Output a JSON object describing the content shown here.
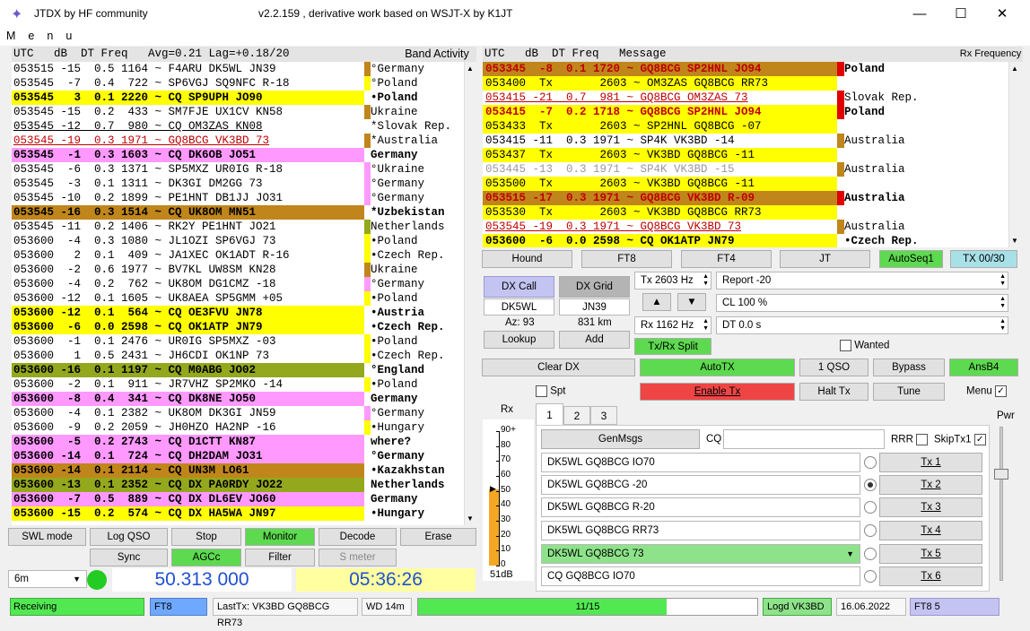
{
  "window": {
    "title": "JTDX  by HF community",
    "subtitle": "v2.2.159 , derivative work based on WSJT-X by K1JT"
  },
  "menu": "Menu",
  "left": {
    "header": "UTC   dB  DT Freq   Avg=0.21 Lag=+0.18/20",
    "band_label": "Band Activity",
    "rows": [
      {
        "t": "053515 -15  0.5 1164 ~ F4ARU DK5WL JN39",
        "m": "°",
        "c": "Germany",
        "bg": "#ffffff",
        "fg": "#000",
        "mk": "#c0861b",
        "bold": false,
        "ul": false
      },
      {
        "t": "053545  -7  0.4  722 ~ SP6VGJ SQ9NFC R-18",
        "m": "°",
        "c": "Poland",
        "bg": "#ffffff",
        "fg": "#000",
        "mk": "#ffff00",
        "bold": false,
        "ul": false
      },
      {
        "t": "053545   3  0.1 2220 ~ CQ SP9UPH JO90",
        "m": "•",
        "c": "Poland",
        "bg": "#ffff00",
        "fg": "#000",
        "mk": "#fff",
        "bold": true,
        "ul": false
      },
      {
        "t": "053545 -15  0.2  433 ~ SM7FJE UX1CV KN58",
        "m": "",
        "c": "Ukraine",
        "bg": "#ffffff",
        "fg": "#000",
        "mk": "#c0861b",
        "bold": false,
        "ul": false
      },
      {
        "t": "053545 -12  0.7  980 ~ CQ OM3ZAS KN08",
        "m": "*",
        "c": "Slovak Rep.",
        "bg": "#ffffff",
        "fg": "#000",
        "mk": "#fff",
        "bold": false,
        "ul": true
      },
      {
        "t": "053545 -19  0.3 1971 ~ GQ8BCG VK3BD 73",
        "m": "*",
        "c": "Australia",
        "bg": "#ffffff",
        "fg": "#c00000",
        "mk": "#c0861b",
        "bold": false,
        "ul": true
      },
      {
        "t": "053545  -1  0.3 1603 ~ CQ DK6OB JO51",
        "m": "",
        "c": "Germany",
        "bg": "#ff99ff",
        "fg": "#000",
        "mk": "#fff",
        "bold": true,
        "ul": false
      },
      {
        "t": "053545  -6  0.3 1371 ~ SP5MXZ UR0IG R-18",
        "m": "°",
        "c": "Ukraine",
        "bg": "#ffffff",
        "fg": "#000",
        "mk": "#ff99ff",
        "bold": false,
        "ul": false
      },
      {
        "t": "053545  -3  0.1 1311 ~ DK3GI DM2GG 73",
        "m": "°",
        "c": "Germany",
        "bg": "#ffffff",
        "fg": "#000",
        "mk": "#ff99ff",
        "bold": false,
        "ul": false
      },
      {
        "t": "053545 -10  0.2 1899 ~ PE1HNT DB1JJ JO31",
        "m": "°",
        "c": "Germany",
        "bg": "#ffffff",
        "fg": "#000",
        "mk": "#ff99ff",
        "bold": false,
        "ul": false
      },
      {
        "t": "053545 -16  0.3 1514 ~ CQ UK8OM MN51",
        "m": "*",
        "c": "Uzbekistan",
        "bg": "#c0861b",
        "fg": "#000",
        "mk": "#fff",
        "bold": true,
        "ul": false
      },
      {
        "t": "053545 -11  0.2 1406 ~ RK2Y PE1HNT JO21",
        "m": "",
        "c": "Netherlands",
        "bg": "#ffffff",
        "fg": "#000",
        "mk": "#93a81c",
        "bold": false,
        "ul": false
      },
      {
        "t": "053600  -4  0.3 1080 ~ JL1OZI SP6VGJ 73",
        "m": "•",
        "c": "Poland",
        "bg": "#ffffff",
        "fg": "#000",
        "mk": "#ffff00",
        "bold": false,
        "ul": false
      },
      {
        "t": "053600   2  0.1  409 ~ JA1XEC OK1ADT R-16",
        "m": "•",
        "c": "Czech Rep.",
        "bg": "#ffffff",
        "fg": "#000",
        "mk": "#ffff00",
        "bold": false,
        "ul": false
      },
      {
        "t": "053600  -2  0.6 1977 ~ BV7KL UW8SM KN28",
        "m": "",
        "c": "Ukraine",
        "bg": "#ffffff",
        "fg": "#000",
        "mk": "#c0861b",
        "bold": false,
        "ul": false
      },
      {
        "t": "053600  -4  0.2  762 ~ UK8OM DG1CMZ -18",
        "m": "°",
        "c": "Germany",
        "bg": "#ffffff",
        "fg": "#000",
        "mk": "#ff99ff",
        "bold": false,
        "ul": false
      },
      {
        "t": "053600 -12  0.1 1605 ~ UK8AEA SP5GMM +05",
        "m": "•",
        "c": "Poland",
        "bg": "#ffffff",
        "fg": "#000",
        "mk": "#ffff00",
        "bold": false,
        "ul": false
      },
      {
        "t": "053600 -12  0.1  564 ~ CQ OE3FVU JN78",
        "m": "•",
        "c": "Austria",
        "bg": "#ffff00",
        "fg": "#000",
        "mk": "#fff",
        "bold": true,
        "ul": false
      },
      {
        "t": "053600  -6  0.0 2598 ~ CQ OK1ATP JN79",
        "m": "•",
        "c": "Czech Rep.",
        "bg": "#ffff00",
        "fg": "#000",
        "mk": "#fff",
        "bold": true,
        "ul": false
      },
      {
        "t": "053600  -1  0.1 2476 ~ UR0IG SP5MXZ -03",
        "m": "•",
        "c": "Poland",
        "bg": "#ffffff",
        "fg": "#000",
        "mk": "#ffff00",
        "bold": false,
        "ul": false
      },
      {
        "t": "053600   1  0.5 2431 ~ JH6CDI OK1NP 73",
        "m": "•",
        "c": "Czech Rep.",
        "bg": "#ffffff",
        "fg": "#000",
        "mk": "#ffff00",
        "bold": false,
        "ul": false
      },
      {
        "t": "053600 -16  0.1 1197 ~ CQ M0ABG JO02",
        "m": "°",
        "c": "England",
        "bg": "#93a81c",
        "fg": "#000",
        "mk": "#fff",
        "bold": true,
        "ul": false
      },
      {
        "t": "053600  -2  0.1  911 ~ JR7VHZ SP2MKO -14",
        "m": "•",
        "c": "Poland",
        "bg": "#ffffff",
        "fg": "#000",
        "mk": "#ffff00",
        "bold": false,
        "ul": false
      },
      {
        "t": "053600  -8  0.4  341 ~ CQ DK8NE JO50",
        "m": "",
        "c": "Germany",
        "bg": "#ff99ff",
        "fg": "#000",
        "mk": "#fff",
        "bold": true,
        "ul": false
      },
      {
        "t": "053600  -4  0.1 2382 ~ UK8OM DK3GI JN59",
        "m": "°",
        "c": "Germany",
        "bg": "#ffffff",
        "fg": "#000",
        "mk": "#ff99ff",
        "bold": false,
        "ul": false
      },
      {
        "t": "053600  -9  0.2 2059 ~ JH0HZO HA2NP -16",
        "m": "•",
        "c": "Hungary",
        "bg": "#ffffff",
        "fg": "#000",
        "mk": "#ffff00",
        "bold": false,
        "ul": false
      },
      {
        "t": "053600  -5  0.2 2743 ~ CQ D1CTT KN87",
        "m": "",
        "c": "where?",
        "bg": "#ff99ff",
        "fg": "#000",
        "mk": "#fff",
        "bold": true,
        "ul": false
      },
      {
        "t": "053600 -14  0.1  724 ~ CQ DH2DAM JO31",
        "m": "°",
        "c": "Germany",
        "bg": "#ff99ff",
        "fg": "#000",
        "mk": "#fff",
        "bold": true,
        "ul": false
      },
      {
        "t": "053600 -14  0.1 2114 ~ CQ UN3M LO61",
        "m": "•",
        "c": "Kazakhstan",
        "bg": "#c0861b",
        "fg": "#000",
        "mk": "#fff",
        "bold": true,
        "ul": false
      },
      {
        "t": "053600 -13  0.1 2352 ~ CQ DX PA0RDY JO22",
        "m": "",
        "c": "Netherlands",
        "bg": "#93a81c",
        "fg": "#000",
        "mk": "#fff",
        "bold": true,
        "ul": false
      },
      {
        "t": "053600  -7  0.5  889 ~ CQ DX DL6EV JO60",
        "m": "",
        "c": "Germany",
        "bg": "#ff99ff",
        "fg": "#000",
        "mk": "#fff",
        "bold": true,
        "ul": false
      },
      {
        "t": "053600 -15  0.2  574 ~ CQ DX HA5WA JN97",
        "m": "•",
        "c": "Hungary",
        "bg": "#ffff00",
        "fg": "#000",
        "mk": "#fff",
        "bold": true,
        "ul": false
      }
    ]
  },
  "right": {
    "header": "UTC   dB  DT Freq   Message",
    "rx_label": "Rx Frequency",
    "rows": [
      {
        "t": "053345  -8  0.1 1720 ~ GQ8BCG SP2HNL JO94",
        "c": "Poland",
        "bg": "#c0861b",
        "fg": "#c00000",
        "mk": "#e00000",
        "ul": false,
        "bold": true
      },
      {
        "t": "053400  Tx       2603 ~ OM3ZAS GQ8BCG RR73",
        "c": "",
        "bg": "#ffff00",
        "fg": "#000",
        "mk": "#fff",
        "ul": false,
        "bold": false
      },
      {
        "t": "053415 -21  0.7  981 ~ GQ8BCG OM3ZAS 73",
        "c": "Slovak Rep.",
        "bg": "#ffffff",
        "fg": "#c00000",
        "mk": "#e00000",
        "ul": true,
        "bold": false
      },
      {
        "t": "053415  -7  0.2 1718 ~ GQ8BCG SP2HNL JO94",
        "c": "Poland",
        "bg": "#ffff00",
        "fg": "#c00000",
        "mk": "#e00000",
        "ul": false,
        "bold": true
      },
      {
        "t": "053433  Tx       2603 ~ SP2HNL GQ8BCG -07",
        "c": "",
        "bg": "#ffff00",
        "fg": "#000",
        "mk": "#fff",
        "ul": false,
        "bold": false
      },
      {
        "t": "053415 -11  0.3 1971 ~ SP4K VK3BD -14",
        "c": "Australia",
        "bg": "#ffffff",
        "fg": "#000",
        "mk": "#c0861b",
        "ul": false,
        "bold": false
      },
      {
        "t": "053437  Tx       2603 ~ VK3BD GQ8BCG -11",
        "c": "",
        "bg": "#ffff00",
        "fg": "#000",
        "mk": "#fff",
        "ul": false,
        "bold": false
      },
      {
        "t": "053445 -13  0.3 1971 ~ SP4K VK3BD -15",
        "c": "Australia",
        "bg": "#ffffff",
        "fg": "#999",
        "mk": "#c0861b",
        "ul": false,
        "bold": false
      },
      {
        "t": "053500  Tx       2603 ~ VK3BD GQ8BCG -11",
        "c": "",
        "bg": "#ffff00",
        "fg": "#000",
        "mk": "#fff",
        "ul": false,
        "bold": false
      },
      {
        "t": "053515 -17  0.3 1971 ~ GQ8BCG VK3BD R-09",
        "c": "Australia",
        "bg": "#c0861b",
        "fg": "#c00000",
        "mk": "#e00000",
        "ul": false,
        "bold": true
      },
      {
        "t": "053530  Tx       2603 ~ VK3BD GQ8BCG RR73",
        "c": "",
        "bg": "#ffff00",
        "fg": "#000",
        "mk": "#fff",
        "ul": false,
        "bold": false
      },
      {
        "t": "053545 -19  0.3 1971 ~ GQ8BCG VK3BD 73",
        "c": "Australia",
        "bg": "#ffffff",
        "fg": "#c00000",
        "mk": "#c0861b",
        "ul": true,
        "bold": false
      },
      {
        "t": "053600  -6  0.0 2598 ~ CQ OK1ATP JN79",
        "c": "•Czech Rep.",
        "bg": "#ffff00",
        "fg": "#000",
        "mk": "#fff",
        "ul": false,
        "bold": true
      }
    ]
  },
  "mode_buttons": [
    "Hound",
    "FT8",
    "FT4",
    "JT",
    "AutoSeq1",
    "TX 00/30"
  ],
  "dx": {
    "call_label": "DX Call",
    "grid_label": "DX Grid",
    "call": "DK5WL",
    "grid": "JN39",
    "az": "Az: 93",
    "dist": "831 km",
    "lookup": "Lookup",
    "add": "Add"
  },
  "tx_freq": "Tx  2603  Hz",
  "rx_freq": "Rx  1162  Hz",
  "report": "Report -20",
  "cl": "CL  100 %",
  "dt": "DT 0.0 s",
  "txrx_split": "Tx/Rx Split",
  "wanted": "Wanted",
  "row_buttons": [
    "Clear DX",
    "AutoTX",
    "1 QSO",
    "Bypass",
    "AnsB4"
  ],
  "spt": "Spt",
  "enable_tx": "Enable Tx",
  "halt_tx": "Halt Tx",
  "tune": "Tune",
  "tabs": [
    "1",
    "2",
    "3"
  ],
  "genmsgs": "GenMsgs",
  "cq": "CQ",
  "rrr": "RRR",
  "skiptx1": "SkipTx1",
  "messages": [
    "DK5WL GQ8BCG IO70",
    "DK5WL GQ8BCG -20",
    "DK5WL GQ8BCG R-20",
    "DK5WL GQ8BCG RR73",
    "DK5WL GQ8BCG 73",
    "CQ GQ8BCG IO70"
  ],
  "tx_buttons": [
    "Tx 1",
    "Tx 2",
    "Tx 3",
    "Tx 4",
    "Tx 5",
    "Tx 6"
  ],
  "rx_meter": {
    "label": "Rx",
    "ticks": [
      "90+",
      "80",
      "70",
      "60",
      "50",
      "40",
      "30",
      "20",
      "10",
      "0"
    ],
    "value": "51dB",
    "level": 51
  },
  "pwr": "Pwr",
  "bottom_buttons": [
    "SWL mode",
    "Log QSO",
    "Stop",
    "Monitor",
    "Decode",
    "Erase",
    "Sync",
    "AGCc",
    "Filter",
    "S meter"
  ],
  "band": "6m",
  "frequency": "50.313 000",
  "time": "05:36:26",
  "status": {
    "receiving": "Receiving",
    "mode": "FT8",
    "last_tx": "LastTx: VK3BD GQ8BCG RR73",
    "wd": "WD 14m",
    "progress": "11/15",
    "progress_frac": 0.733,
    "logd": "Logd VK3BD",
    "date": "16.06.2022",
    "mode_count": "FT8  5"
  }
}
